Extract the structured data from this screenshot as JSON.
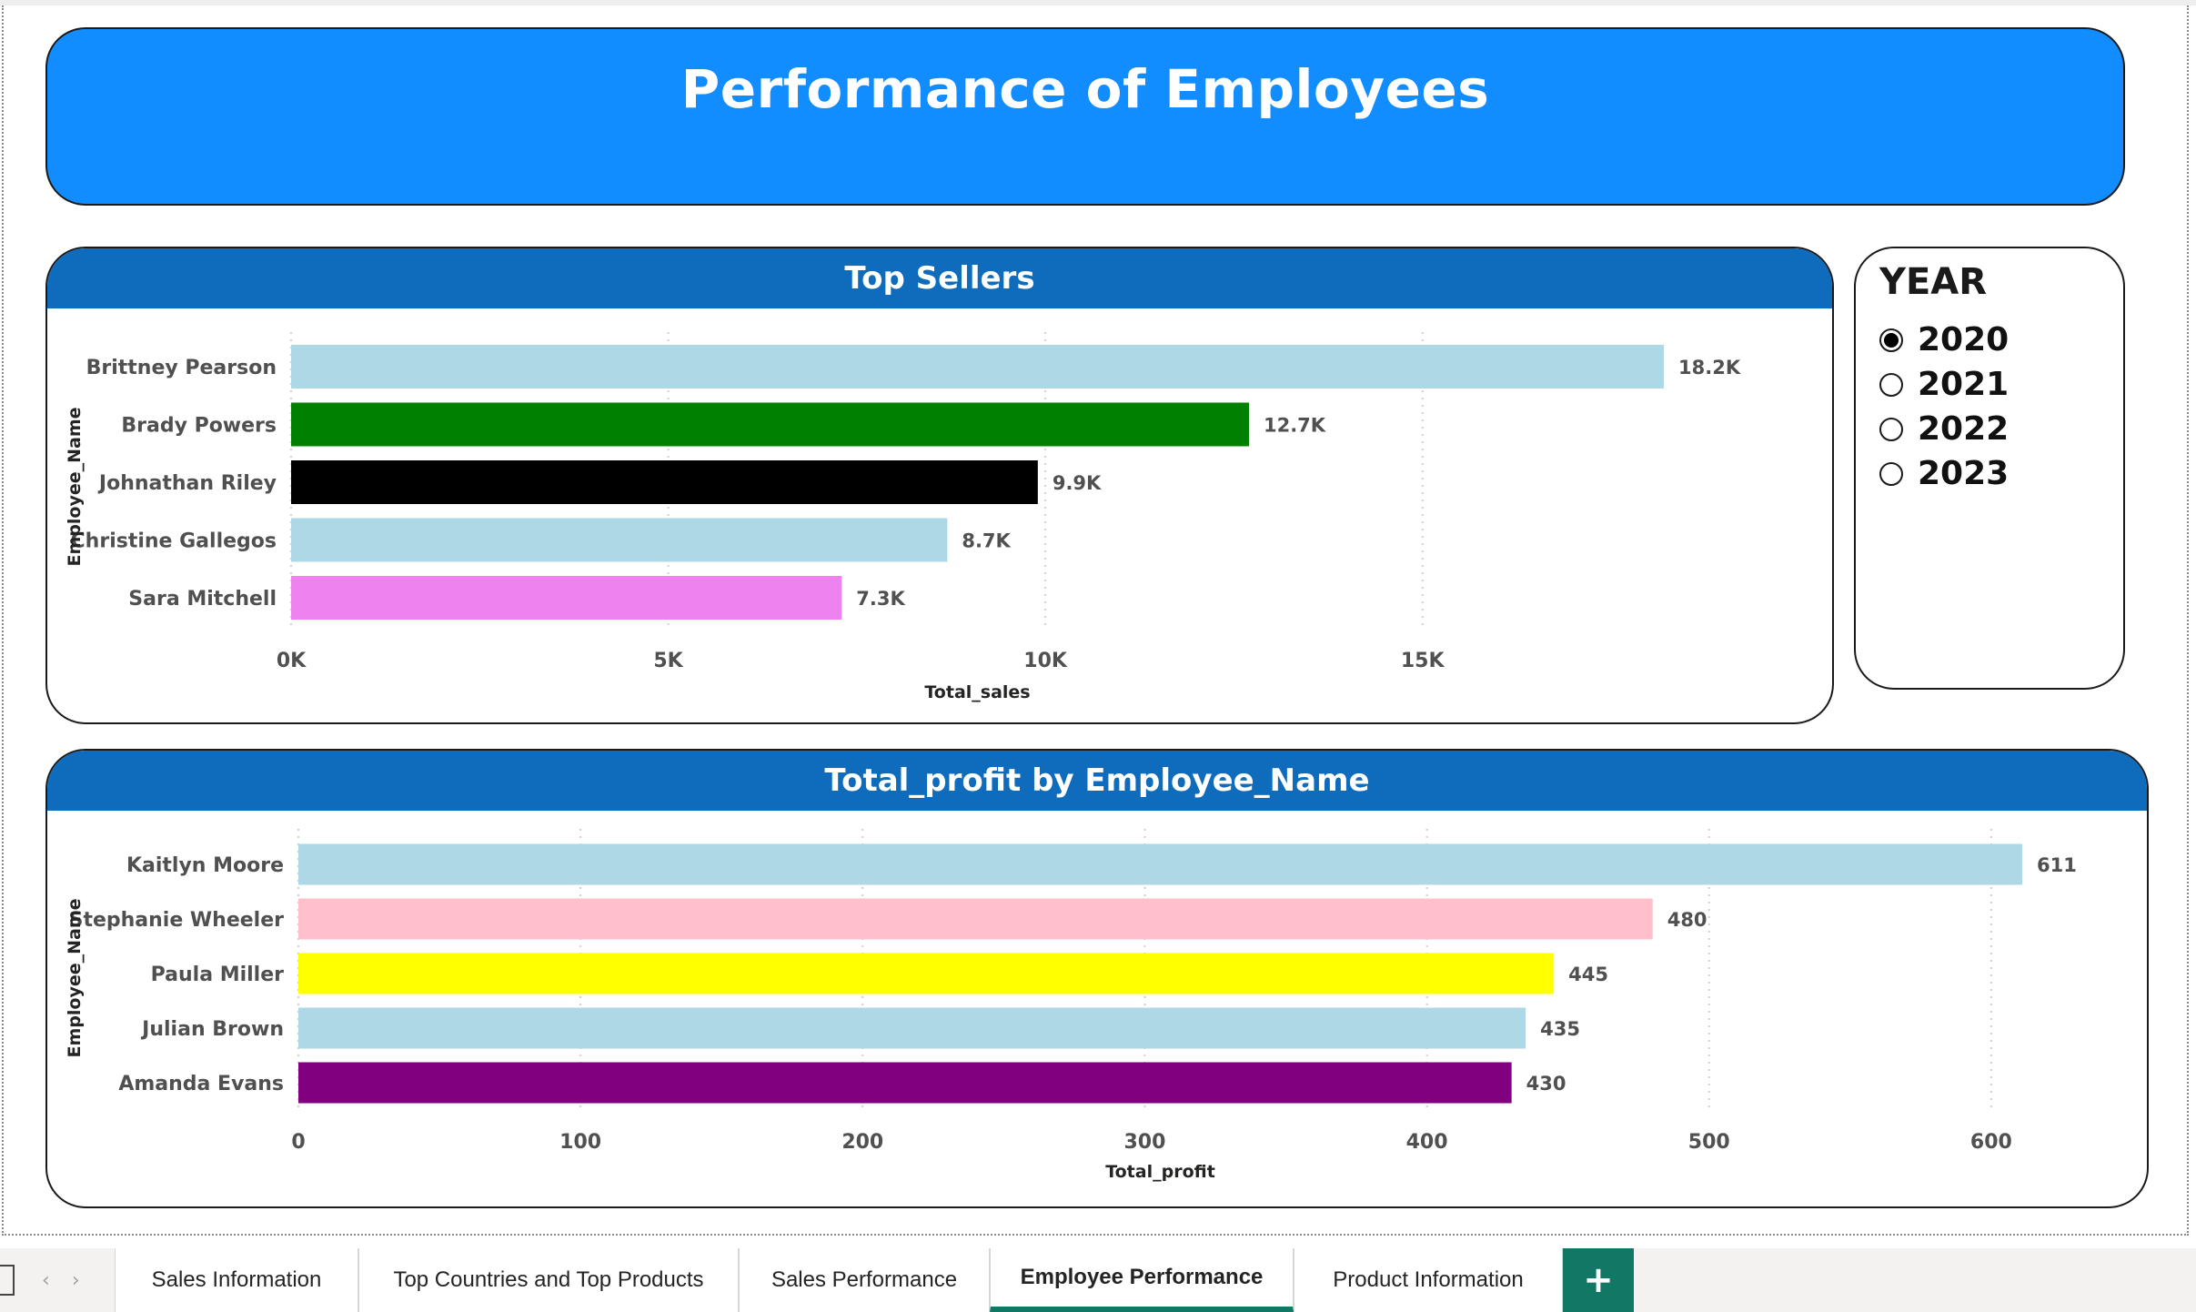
{
  "header": {
    "title": "Performance of Employees"
  },
  "colors": {
    "banner": "#118dff",
    "panel_header": "#0f6cbd",
    "tab_accent": "#117865"
  },
  "chart_data": [
    {
      "type": "bar",
      "orientation": "horizontal",
      "title": "Top Sellers",
      "xlabel": "Total_sales",
      "ylabel": "Employee_Name",
      "categories": [
        "Brittney Pearson",
        "Brady Powers",
        "Johnathan Riley",
        "Christine Gallegos",
        "Sara Mitchell"
      ],
      "values": [
        18200,
        12700,
        9900,
        8700,
        7300
      ],
      "data_labels": [
        "18.2K",
        "12.7K",
        "9.9K",
        "8.7K",
        "7.3K"
      ],
      "colors": [
        "#add8e6",
        "#008000",
        "#000000",
        "#add8e6",
        "#ee82ee"
      ],
      "xticks": [
        0,
        5000,
        10000,
        15000
      ],
      "xtick_labels": [
        "0K",
        "5K",
        "10K",
        "15K"
      ],
      "xlim": [
        0,
        18200
      ],
      "grid": true
    },
    {
      "type": "bar",
      "orientation": "horizontal",
      "title": "Total_profit by Employee_Name",
      "xlabel": "Total_profit",
      "ylabel": "Employee_Name",
      "categories": [
        "Kaitlyn Moore",
        "Stephanie Wheeler",
        "Paula Miller",
        "Julian Brown",
        "Amanda Evans"
      ],
      "values": [
        611,
        480,
        445,
        435,
        430
      ],
      "data_labels": [
        "611",
        "480",
        "445",
        "435",
        "430"
      ],
      "colors": [
        "#add8e6",
        "#ffc0cb",
        "#ffff00",
        "#add8e6",
        "#800080"
      ],
      "xticks": [
        0,
        100,
        200,
        300,
        400,
        500,
        600
      ],
      "xtick_labels": [
        "0",
        "100",
        "200",
        "300",
        "400",
        "500",
        "600"
      ],
      "xlim": [
        0,
        611
      ],
      "grid": true
    }
  ],
  "slicer": {
    "title": "YEAR",
    "options": [
      {
        "label": "2020",
        "selected": true
      },
      {
        "label": "2021",
        "selected": false
      },
      {
        "label": "2022",
        "selected": false
      },
      {
        "label": "2023",
        "selected": false
      }
    ]
  },
  "tabs": {
    "items": [
      {
        "label": "Sales Information",
        "active": false
      },
      {
        "label": "Top Countries and Top Products",
        "active": false
      },
      {
        "label": "Sales Performance",
        "active": false
      },
      {
        "label": "Employee Performance",
        "active": true
      },
      {
        "label": "Product Information",
        "active": false
      }
    ],
    "add_label": "+",
    "nav_prev": "‹",
    "nav_next": "›"
  }
}
